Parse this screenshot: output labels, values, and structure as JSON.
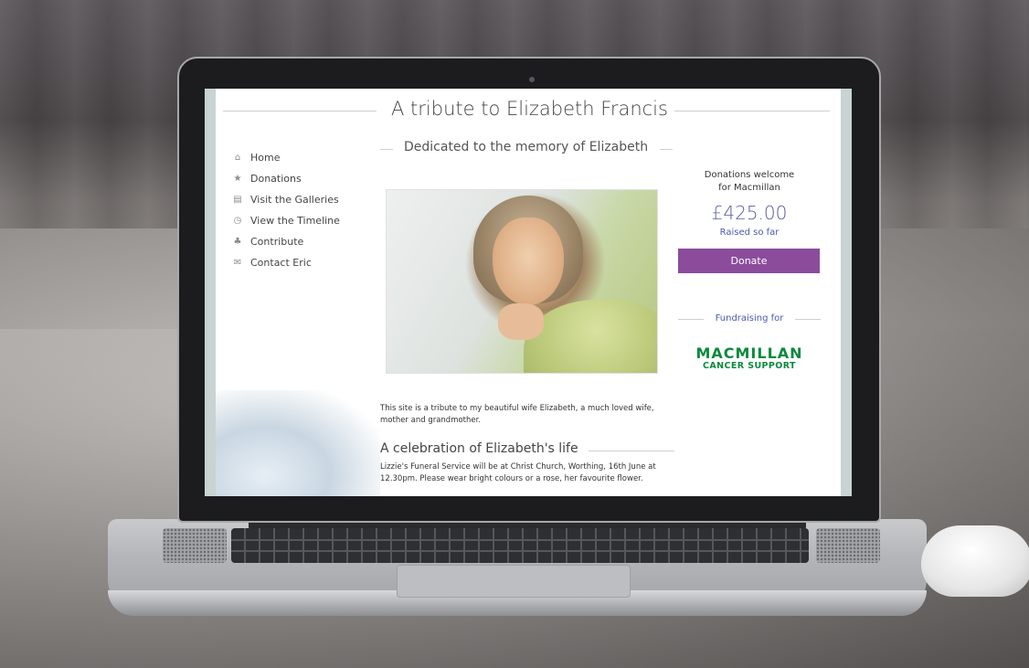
{
  "site": {
    "title": "A tribute to Elizabeth Francis",
    "dedicated": "Dedicated to the memory of Elizabeth",
    "nav": [
      {
        "label": "Home",
        "icon": "home-icon"
      },
      {
        "label": "Donations",
        "icon": "star-icon"
      },
      {
        "label": "Visit the Galleries",
        "icon": "gallery-icon"
      },
      {
        "label": "View the Timeline",
        "icon": "clock-icon"
      },
      {
        "label": "Contribute",
        "icon": "contribute-icon"
      },
      {
        "label": "Contact Eric",
        "icon": "envelope-icon"
      }
    ],
    "intro": "This site is a tribute to my beautiful wife Elizabeth, a much loved wife, mother and grandmother.",
    "celebration_heading": "A celebration of Elizabeth's life",
    "funeral_text": "Lizzie's Funeral Service will be at Christ Church, Worthing, 16th June at 12.30pm. Please wear bright colours or a rose, her favourite flower.",
    "donations": {
      "welcome_line1": "Donations welcome",
      "welcome_line2": "for Macmillan",
      "amount": "£425.00",
      "raised_label": "Raised so far",
      "button_label": "Donate"
    },
    "fundraising_label": "Fundraising for",
    "logo": {
      "line1": "MACMILLAN",
      "line2": "CANCER SUPPORT"
    },
    "colors": {
      "donate_button": "#8b4c9c",
      "amount": "#5b59a8",
      "logo_green": "#0b8a3c"
    }
  }
}
